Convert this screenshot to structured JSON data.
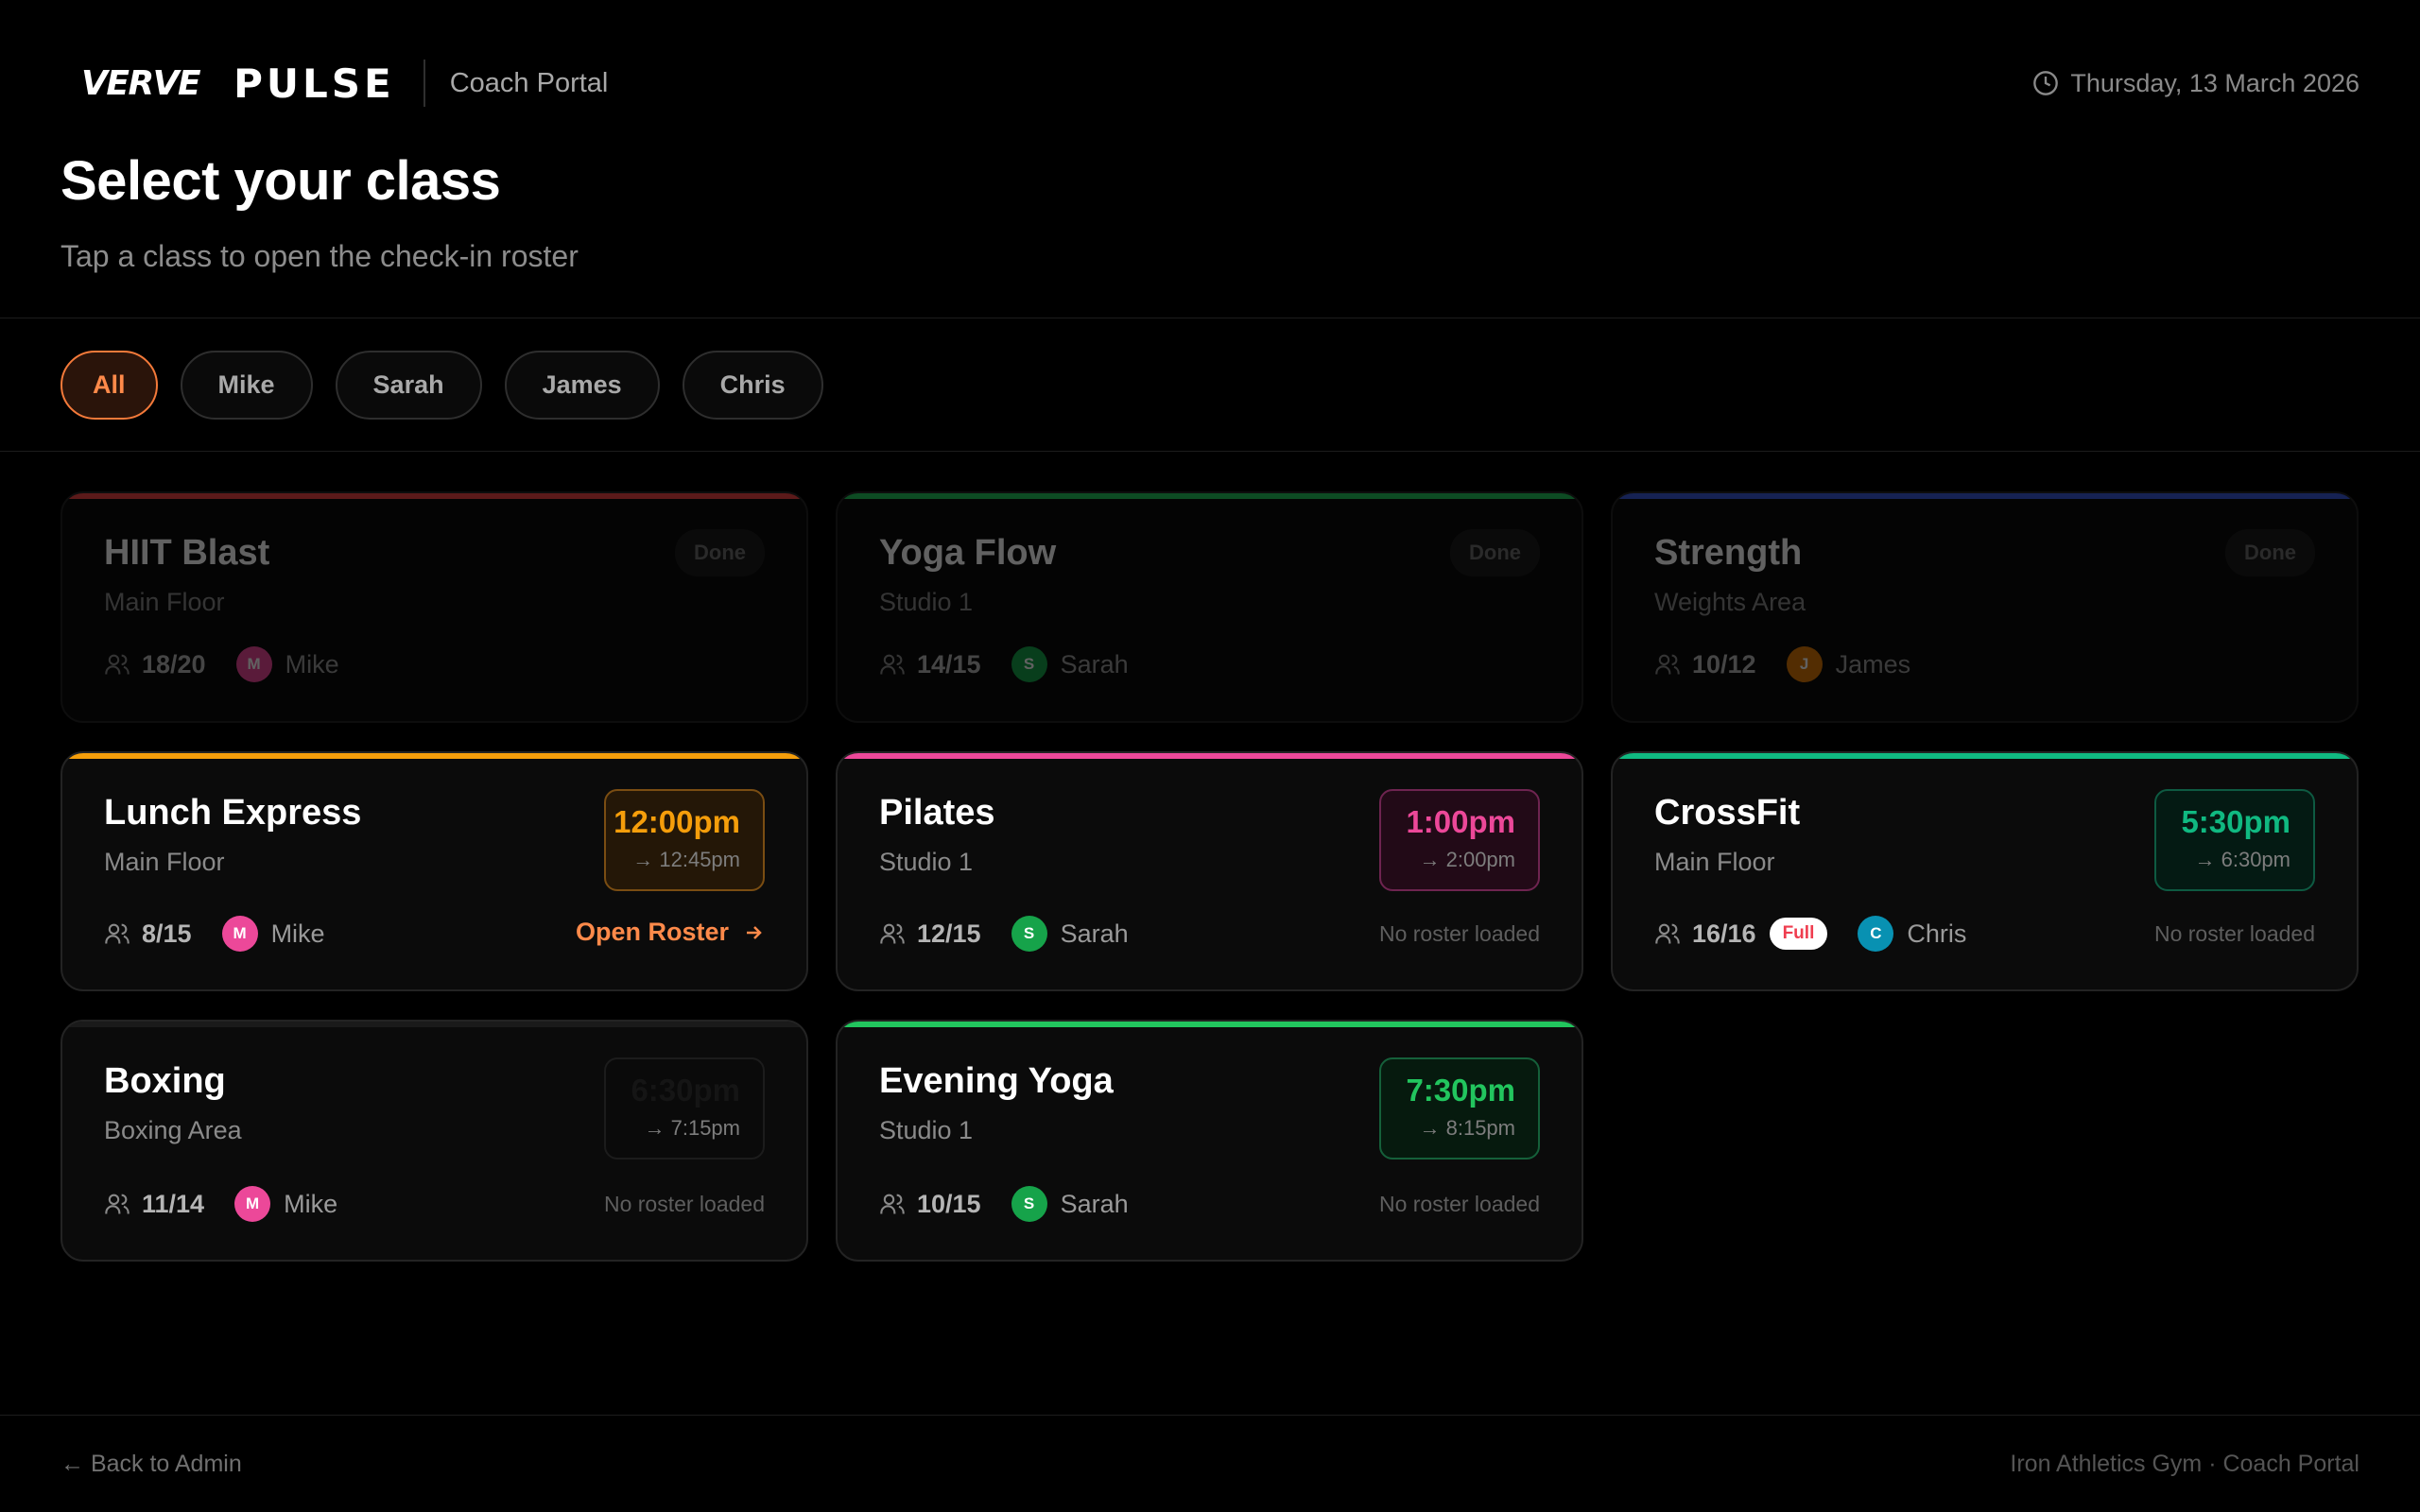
{
  "header": {
    "brand_verve": "VERVE",
    "brand_pulse": "PULSE",
    "portal": "Coach Portal",
    "date": "Thursday, 13 March 2026"
  },
  "page": {
    "title": "Select your class",
    "subtitle": "Tap a class to open the check-in roster"
  },
  "filters": [
    "All",
    "Mike",
    "Sarah",
    "James",
    "Chris"
  ],
  "colors": {
    "accent": "#ff8a4a",
    "background": "#000000",
    "card": "#0b0b0b"
  },
  "classes": [
    {
      "name": "HIIT Blast",
      "location": "Main Floor",
      "count": "18/20",
      "coach": "Mike",
      "initial": "M",
      "status": "Done",
      "accent": "#ef4444",
      "avatar": "#ec4899"
    },
    {
      "name": "Yoga Flow",
      "location": "Studio 1",
      "count": "14/15",
      "coach": "Sarah",
      "initial": "S",
      "status": "Done",
      "accent": "#22c55e",
      "avatar": "#16a34a"
    },
    {
      "name": "Strength",
      "location": "Weights Area",
      "count": "10/12",
      "coach": "James",
      "initial": "J",
      "status": "Done",
      "accent": "#3b5bdb",
      "avatar": "#d97706"
    },
    {
      "name": "Lunch Express",
      "location": "Main Floor",
      "count": "8/15",
      "coach": "Mike",
      "initial": "M",
      "start": "12:00pm",
      "end": "→ 12:45pm",
      "action": "Open Roster",
      "accent": "#f59e0b",
      "avatar": "#ec4899"
    },
    {
      "name": "Pilates",
      "location": "Studio 1",
      "count": "12/15",
      "coach": "Sarah",
      "initial": "S",
      "start": "1:00pm",
      "end": "→ 2:00pm",
      "roster": "No roster loaded",
      "accent": "#ec4899",
      "avatar": "#16a34a"
    },
    {
      "name": "CrossFit",
      "location": "Main Floor",
      "count": "16/16",
      "full": "Full",
      "coach": "Chris",
      "initial": "C",
      "start": "5:30pm",
      "end": "→ 6:30pm",
      "roster": "No roster loaded",
      "accent": "#10b981",
      "avatar": "#0891b2"
    },
    {
      "name": "Boxing",
      "location": "Boxing Area",
      "count": "11/14",
      "coach": "Mike",
      "initial": "M",
      "start": "6:30pm",
      "end": "→ 7:15pm",
      "roster": "No roster loaded",
      "accent": "#1a1a1a",
      "avatar": "#ec4899"
    },
    {
      "name": "Evening Yoga",
      "location": "Studio 1",
      "count": "10/15",
      "coach": "Sarah",
      "initial": "S",
      "start": "7:30pm",
      "end": "→ 8:15pm",
      "roster": "No roster loaded",
      "accent": "#22c55e",
      "avatar": "#16a34a"
    }
  ],
  "footer": {
    "back": "← Back to Admin",
    "right": "Iron Athletics Gym · Coach Portal"
  }
}
